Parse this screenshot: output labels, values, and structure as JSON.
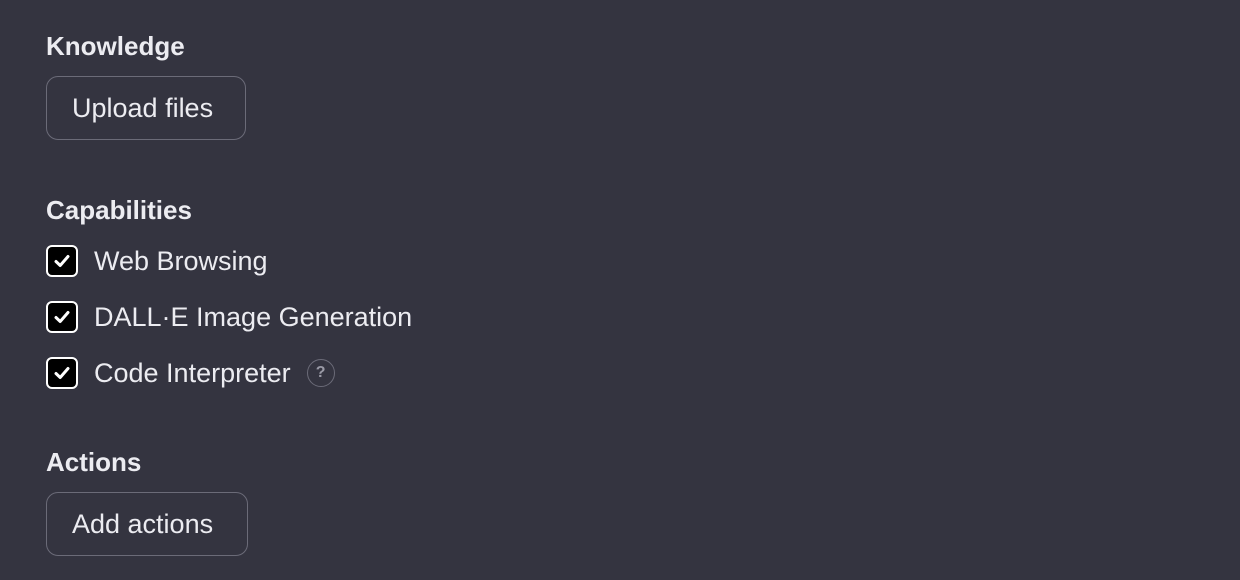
{
  "knowledge": {
    "title": "Knowledge",
    "upload_label": "Upload files"
  },
  "capabilities": {
    "title": "Capabilities",
    "items": [
      {
        "label": "Web Browsing",
        "checked": true
      },
      {
        "label": "DALL·E Image Generation",
        "checked": true
      },
      {
        "label": "Code Interpreter",
        "checked": true,
        "help_icon": "question-circle-icon",
        "help_glyph": "?"
      }
    ]
  },
  "actions": {
    "title": "Actions",
    "add_label": "Add actions"
  },
  "colors": {
    "background": "#343440",
    "text": "#ececf1",
    "border": "#6b6b78",
    "checkbox_fill": "#000000",
    "checkmark": "#ffffff"
  }
}
